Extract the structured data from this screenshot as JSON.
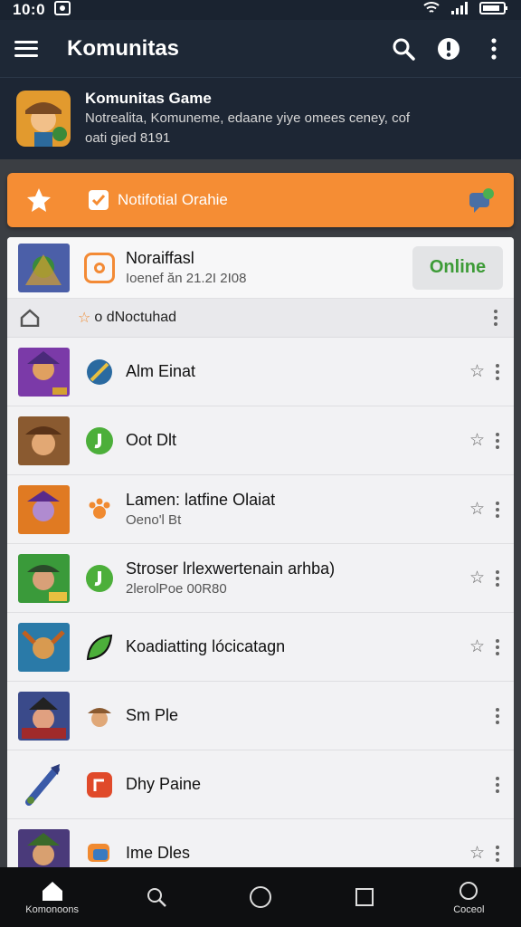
{
  "status_bar": {
    "time": "10:0"
  },
  "app_bar": {
    "title": "Komunitas"
  },
  "community": {
    "title": "Komunitas Game",
    "description_line1": "Notrealita, Komuneme, edaane yiye omees ceney, cof",
    "description_line2": "oati gied 8191"
  },
  "banner": {
    "label": "Notifotial Orahie"
  },
  "header_item": {
    "title": "Noraiffasl",
    "subtitle": "Ioenef ăn 21.2I 2I08",
    "online_label": "Online"
  },
  "sub_row": {
    "label": "o dNoctuhad"
  },
  "items": [
    {
      "title": "Alm Einat",
      "subtitle": "",
      "star": true
    },
    {
      "title": "Oot Dlt",
      "subtitle": "",
      "star": true
    },
    {
      "title": "Lamen: latfine Olaiat",
      "subtitle": "Oeno'l Bt",
      "star": true
    },
    {
      "title": "Stroser lrlexwertenain arhba)",
      "subtitle": "2lerolPoe 00R80",
      "star": true
    },
    {
      "title": "Koadiatting lócicatagn",
      "subtitle": "",
      "star": true
    },
    {
      "title": "Sm Ple",
      "subtitle": "",
      "star": false
    },
    {
      "title": "Dhy Paine",
      "subtitle": "",
      "star": false
    },
    {
      "title": "Ime Dles",
      "subtitle": "",
      "star": true
    }
  ],
  "bottom_nav": {
    "home_label": "Komonoons",
    "last_label": "Coceol"
  },
  "colors": {
    "accent_orange": "#f58d34",
    "online_green": "#3d9b37",
    "app_bar": "#1e2836"
  },
  "icons": {
    "status": [
      "wifi-icon",
      "signal-icon",
      "battery-icon"
    ],
    "app_bar": [
      "menu-icon",
      "search-icon",
      "alert-icon",
      "more-vert-icon"
    ],
    "bottom_nav": [
      "home-icon",
      "search-icon",
      "circle-icon",
      "square-icon",
      "circle-icon"
    ]
  }
}
